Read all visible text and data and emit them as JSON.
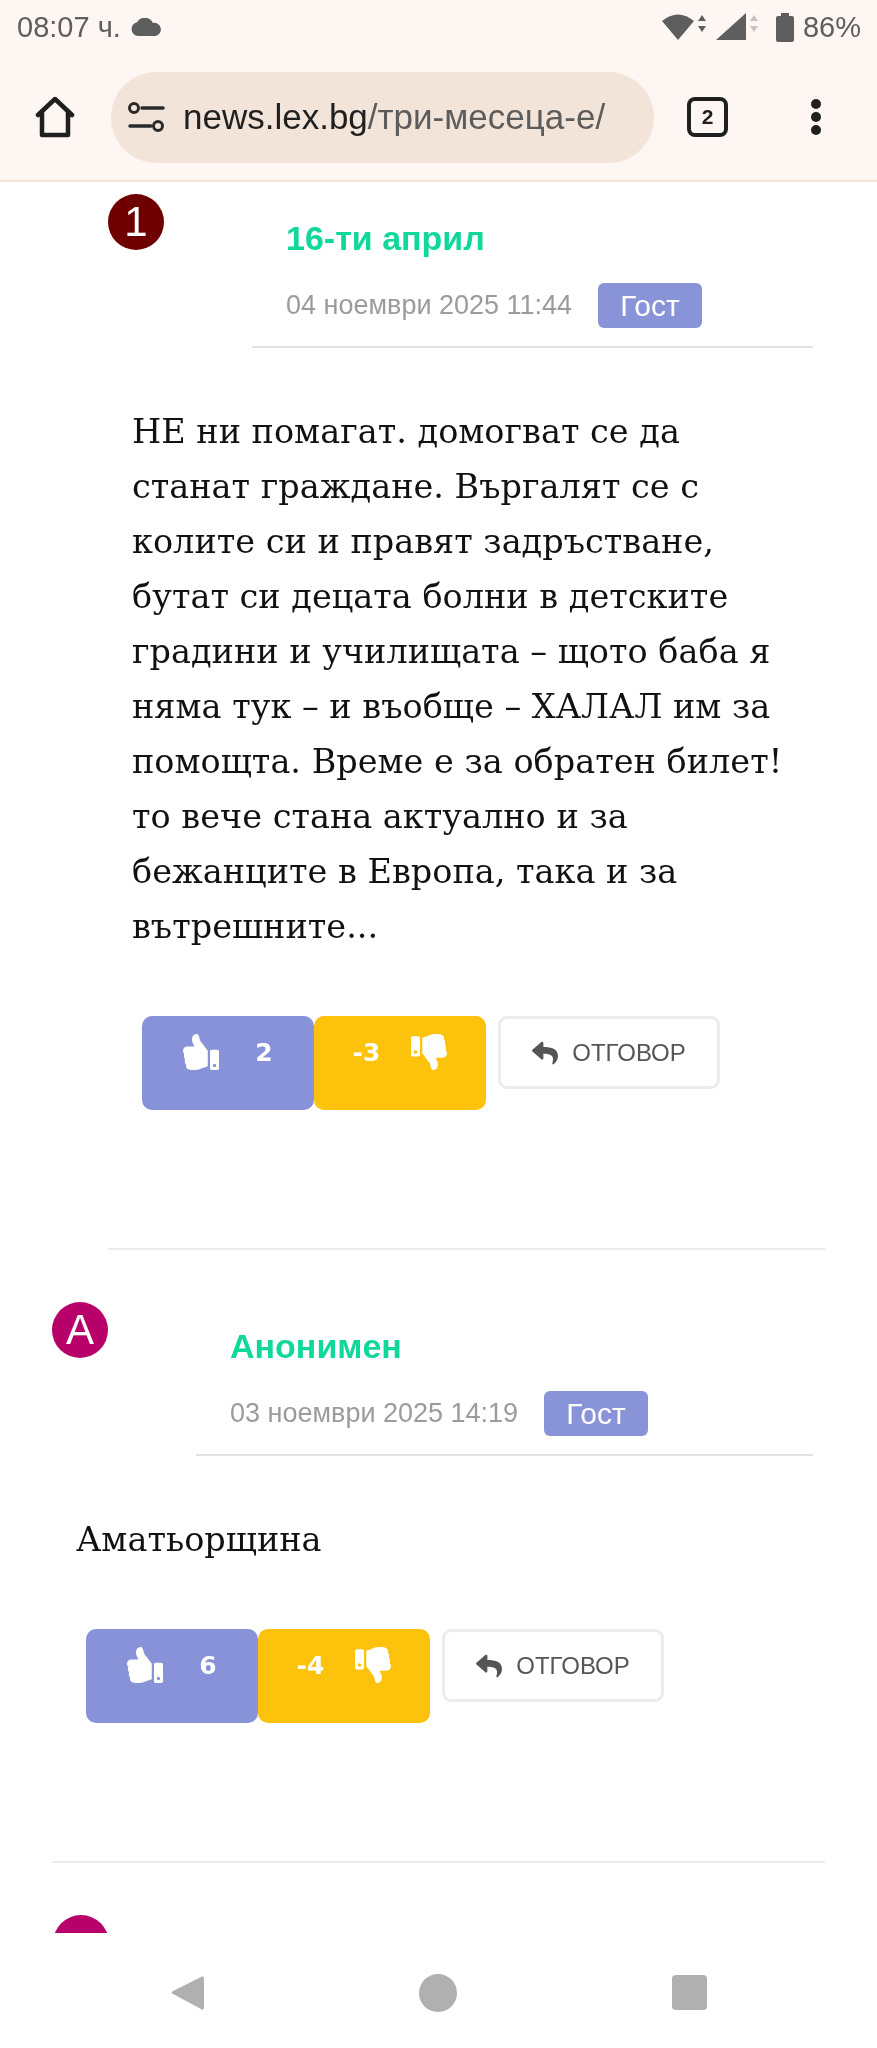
{
  "status_bar": {
    "time": "08:07 ч.",
    "battery": "86%"
  },
  "browser": {
    "url": {
      "host": "news.lex.bg",
      "path": "/три-месеца-е/"
    },
    "tab_count": "2"
  },
  "replies": [
    {
      "avatar": {
        "letter": "1",
        "color": "#6e0000"
      },
      "author": "16-ти април",
      "date": "04 ноември 2025 11:44",
      "badge": "Гост",
      "text": "НЕ ни помагат. домогват се да станат граждане. Въргалят се с колите си и правят задръстване, бутат си децата болни в детските градини и училищата – щото баба я няма тук – и въобще – ХАЛАЛ им за помощта. Време е за обратен билет! то вече стана актуално и за бежанците в Европа, така и за вътрешните...",
      "likes": "2",
      "dislikes": "-3",
      "reply_label": "ОТГОВОР"
    }
  ],
  "comments": [
    {
      "avatar": {
        "letter": "А",
        "color": "#b8006b"
      },
      "author": "Анонимен",
      "date": "03 ноември 2025 14:19",
      "badge": "Гост",
      "text": "Аматьорщина",
      "likes": "6",
      "dislikes": "-4",
      "reply_label": "ОТГОВОР"
    }
  ],
  "next_comment": {
    "avatar": {
      "color": "#b8006b"
    }
  }
}
